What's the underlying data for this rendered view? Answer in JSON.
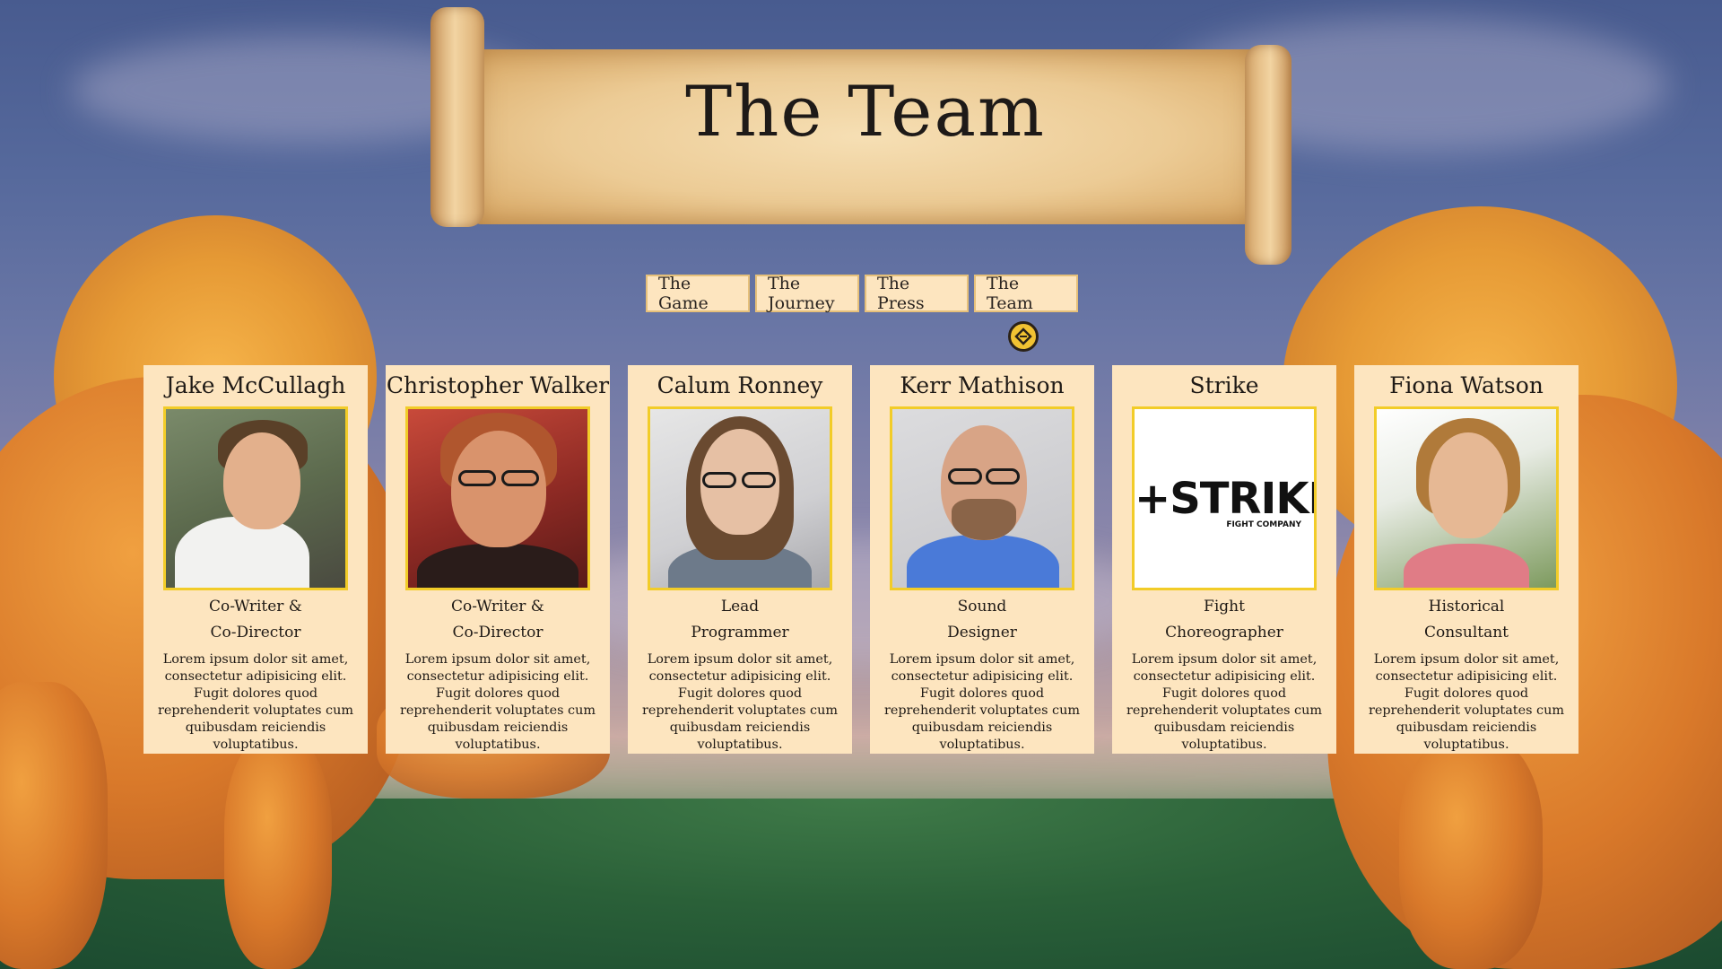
{
  "header": {
    "title": "The Team"
  },
  "nav": {
    "items": [
      {
        "label": "The Game"
      },
      {
        "label": "The Journey"
      },
      {
        "label": "The Press"
      },
      {
        "label": "The Team"
      }
    ],
    "active_index": 3
  },
  "team": [
    {
      "name": "Jake McCullagh",
      "role_line1": "Co-Writer &",
      "role_line2": "Co-Director",
      "bio": "Lorem ipsum dolor sit amet, consectetur adipisicing elit. Fugit dolores quod reprehenderit voluptates cum quibusdam reiciendis voluptatibus."
    },
    {
      "name": "Christopher Walker",
      "role_line1": "Co-Writer &",
      "role_line2": "Co-Director",
      "bio": "Lorem ipsum dolor sit amet, consectetur adipisicing elit. Fugit dolores quod reprehenderit voluptates cum quibusdam reiciendis voluptatibus."
    },
    {
      "name": "Calum Ronney",
      "role_line1": "Lead",
      "role_line2": "Programmer",
      "bio": "Lorem ipsum dolor sit amet, consectetur adipisicing elit. Fugit dolores quod reprehenderit voluptates cum quibusdam reiciendis voluptatibus."
    },
    {
      "name": "Kerr Mathison",
      "role_line1": "Sound",
      "role_line2": "Designer",
      "bio": "Lorem ipsum dolor sit amet, consectetur adipisicing elit. Fugit dolores quod reprehenderit voluptates cum quibusdam reiciendis voluptatibus."
    },
    {
      "name": "Strike",
      "role_line1": "Fight",
      "role_line2": "Choreographer",
      "bio": "Lorem ipsum dolor sit amet, consectetur adipisicing elit. Fugit dolores quod reprehenderit voluptates cum quibusdam reiciendis voluptatibus.",
      "logo_text": "+STRIKE",
      "logo_subtext": "FIGHT COMPANY"
    },
    {
      "name": "Fiona Watson",
      "role_line1": "Historical",
      "role_line2": "Consultant",
      "bio": "Lorem ipsum dolor sit amet, consectetur adipisicing elit. Fugit dolores quod reprehenderit voluptates cum quibusdam reiciendis voluptatibus."
    }
  ],
  "colors": {
    "card_bg": "#fde5bf",
    "photo_border": "#f2cc28",
    "text": "#1f1a16",
    "sky": "#56699c"
  }
}
